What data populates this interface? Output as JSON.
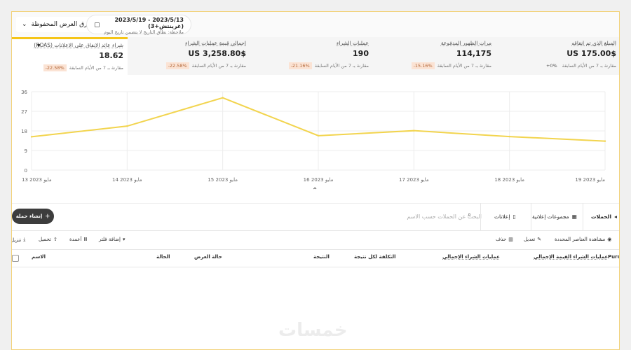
{
  "topbar": {
    "saved_views_label": "طرق العرض المحفوظة",
    "date_range": "2023/5/13 - 2023/5/19 (غرينتش+3)",
    "date_note": "ملاحظة: نطاق التاريخ لا يتضمن تاريخ اليوم"
  },
  "metrics": [
    {
      "label": "المبلغ الذي تم إنفاقه",
      "value": "$US 175.00",
      "badge": "+0%",
      "compare": "مقارنة بـ 7 من الأيام السابقة"
    },
    {
      "label": "مرات الظهور المدفوعة",
      "value": "114,175",
      "badge": "-15.16%",
      "compare": "مقارنة بـ 7 من الأيام السابقة"
    },
    {
      "label": "عمليات الشراء",
      "value": "190",
      "badge": "-21.16%",
      "compare": "مقارنة بـ 7 من الأيام السابقة"
    },
    {
      "label": "إجمالي قيمة عمليات الشراء",
      "value": "$US 3,258.80",
      "badge": "-22.58%",
      "compare": "مقارنة بـ 7 من الأيام السابقة"
    },
    {
      "label": "شراء عائد الإنفاق على الإعلانات (ROAS)",
      "value": "18.62",
      "badge": "-22.58%",
      "compare": "مقارنة بـ 7 من الأيام السابقة"
    }
  ],
  "chart_data": {
    "type": "line",
    "x": [
      "13 مايو 2023",
      "14 مايو 2023",
      "15 مايو 2023",
      "16 مايو 2023",
      "17 مايو 2023",
      "18 مايو 2023",
      "19 مايو 2023"
    ],
    "series": [
      {
        "values": [
          15.3,
          20.2,
          33.2,
          15.8,
          18.1,
          15.4,
          13.3
        ]
      }
    ],
    "yticks": [
      0,
      9,
      18,
      27,
      36
    ],
    "ylim": [
      0,
      36
    ],
    "color": "#f2d44e",
    "grid": true
  },
  "toolbar": {
    "create_label": "إنشاء حملة",
    "search_placeholder": "البحث عن الحملات حسب الاسم",
    "tabs": [
      {
        "label": "الحملات"
      },
      {
        "label": "مجموعات إعلانية"
      },
      {
        "label": "إعلانات"
      }
    ]
  },
  "actions": {
    "view_selected": "مشاهدة العناصر المحددة",
    "edit": "تعديل",
    "delete": "حذف",
    "add_filter": "إضافة فلتر",
    "columns": "أعمدة",
    "upload": "تحميل",
    "download": "تنزيل"
  },
  "table": {
    "headers": {
      "name": "الاسم",
      "status": "الحالة",
      "delivery": "حالة العرض",
      "result": "النتيجة",
      "cost_per_result": "التكلفة لكل نتيجة",
      "purchases_total": "عمليات الشراء الإجمالي",
      "purchase_value_total": "عمليات الشراء القيمة الإجمالي",
      "purch": "Purch"
    }
  },
  "watermark": "خمسات"
}
